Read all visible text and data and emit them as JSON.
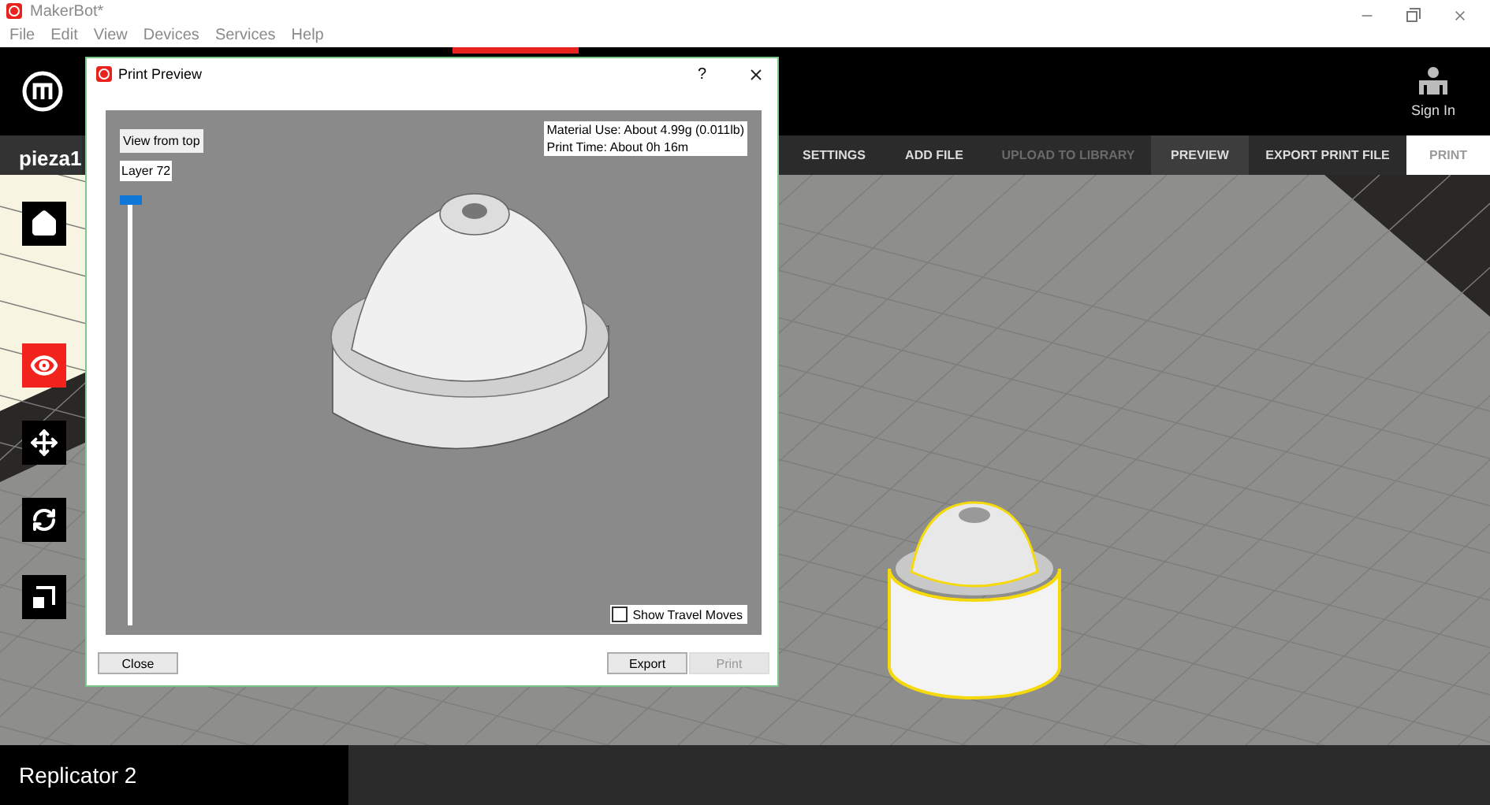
{
  "window": {
    "title": "MakerBot*"
  },
  "menu": [
    "File",
    "Edit",
    "View",
    "Devices",
    "Services",
    "Help"
  ],
  "header": {
    "sign_in": "Sign In"
  },
  "file_tab": "pieza1",
  "toolbar": [
    {
      "label": "SETTINGS",
      "kind": "tab",
      "selected": false,
      "disabled": false
    },
    {
      "label": "ADD FILE",
      "kind": "tab",
      "selected": false,
      "disabled": false
    },
    {
      "label": "UPLOAD TO LIBRARY",
      "kind": "tab",
      "selected": false,
      "disabled": true
    },
    {
      "label": "PREVIEW",
      "kind": "tab",
      "selected": true,
      "disabled": false
    },
    {
      "label": "EXPORT PRINT FILE",
      "kind": "tab",
      "selected": false,
      "disabled": false
    },
    {
      "label": "PRINT",
      "kind": "primary",
      "selected": false,
      "disabled": true
    }
  ],
  "tools": [
    {
      "kind": "home",
      "selected": false
    },
    {
      "kind": "view",
      "selected": true
    },
    {
      "kind": "move",
      "selected": false
    },
    {
      "kind": "rotate",
      "selected": false
    },
    {
      "kind": "scale",
      "selected": false
    }
  ],
  "printer": "Replicator 2",
  "dialog": {
    "title": "Print Preview",
    "help": "?",
    "view_button": "View from top",
    "layer_label": "Layer 72",
    "layer_slider": {
      "level": 1
    },
    "info": [
      "Material Use: About 4.99g (0.011lb)",
      "Print Time: About 0h 16m"
    ],
    "travel_moves": {
      "label": "Show Travel Moves",
      "checked": false
    },
    "buttons": [
      {
        "label": "Close",
        "disabled": false
      },
      {
        "label": "Export",
        "disabled": false
      },
      {
        "label": "Print",
        "disabled": true
      }
    ]
  }
}
